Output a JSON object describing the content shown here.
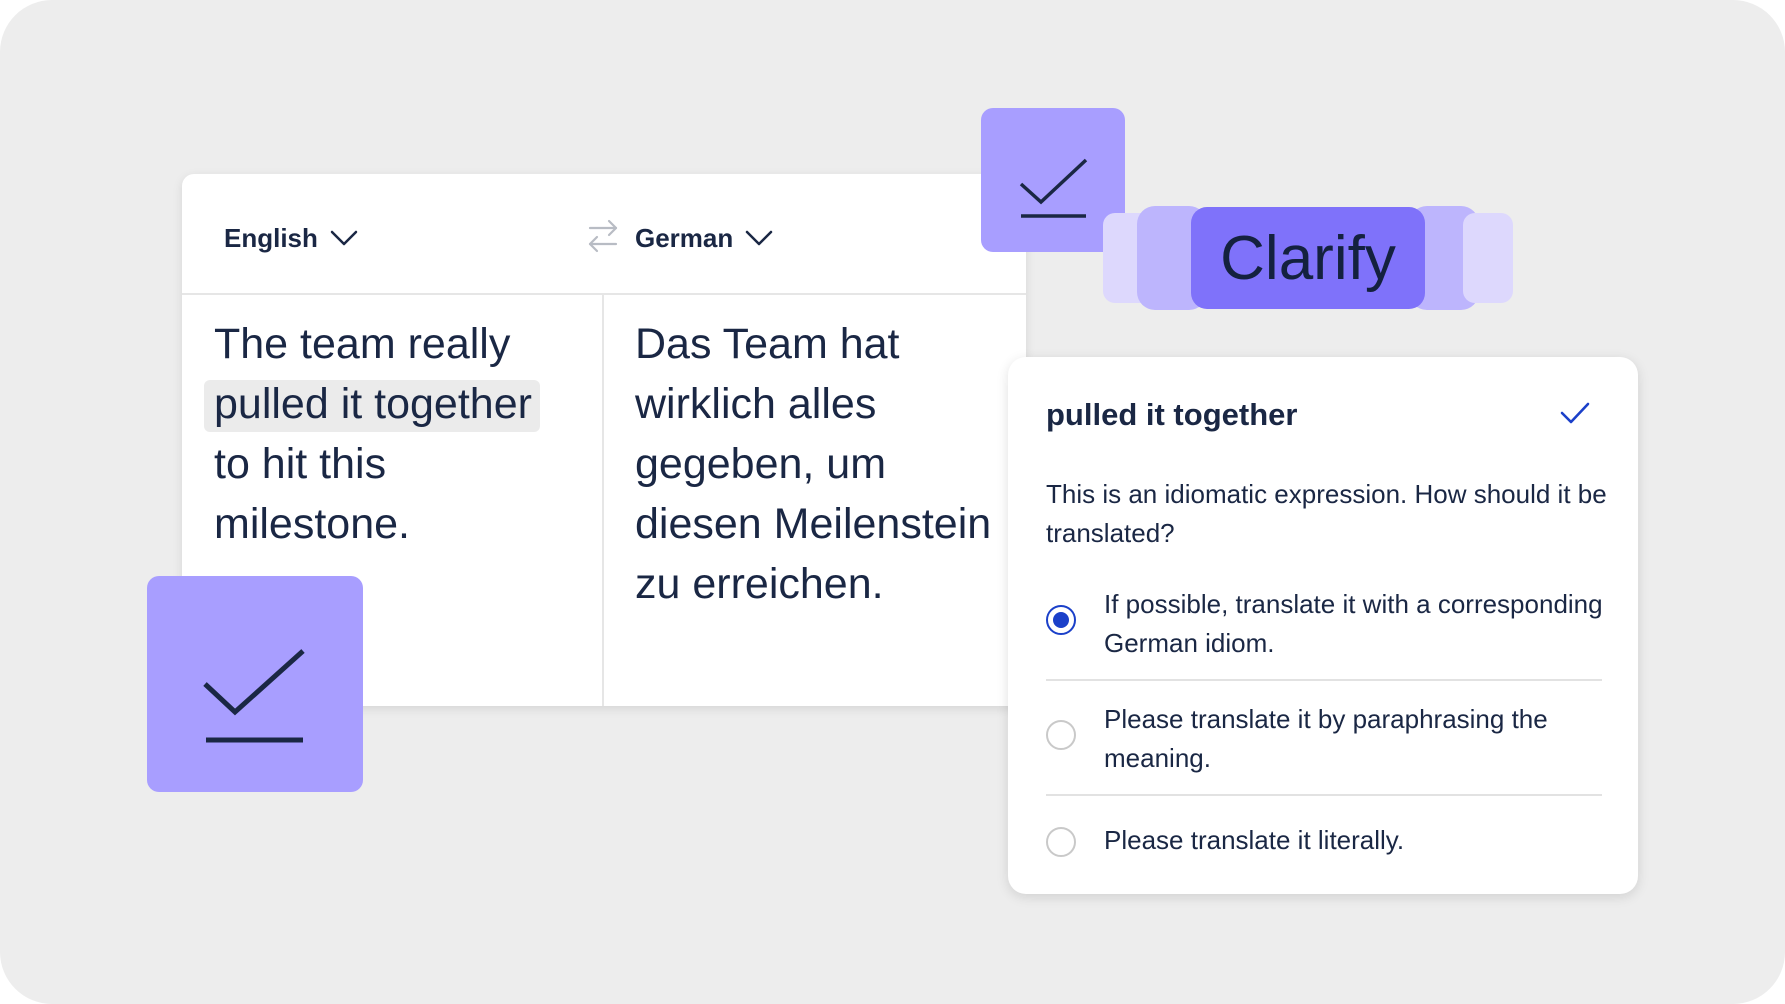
{
  "colors": {
    "background": "#ededed",
    "card": "#ffffff",
    "accent": "#7f72fa",
    "tile": "#a89eff",
    "text": "#1a2744",
    "radio_selected": "#1b40c9"
  },
  "translator": {
    "source_language": "English",
    "target_language": "German",
    "swap_icon": "swap-arrows-icon",
    "source_text_before": "The team really ",
    "source_highlight": "pulled it together",
    "source_text_after": " to hit this milestone.",
    "target_text": "Das Team hat wirklich alles gegeben, um diesen Meilenstein zu erreichen."
  },
  "clarify": {
    "button_label": "Clarify"
  },
  "popup": {
    "title": "pulled it together",
    "confirm_icon": "checkmark-icon",
    "question": "This is an idiomatic expression. How should it be translated?",
    "options": [
      {
        "label": "If possible, translate it with a corresponding German idiom.",
        "selected": true
      },
      {
        "label": "Please translate it by paraphrasing the meaning.",
        "selected": false
      },
      {
        "label": "Please translate it literally.",
        "selected": false
      }
    ]
  },
  "decorations": {
    "tile_icon": "check-accept-icon"
  }
}
